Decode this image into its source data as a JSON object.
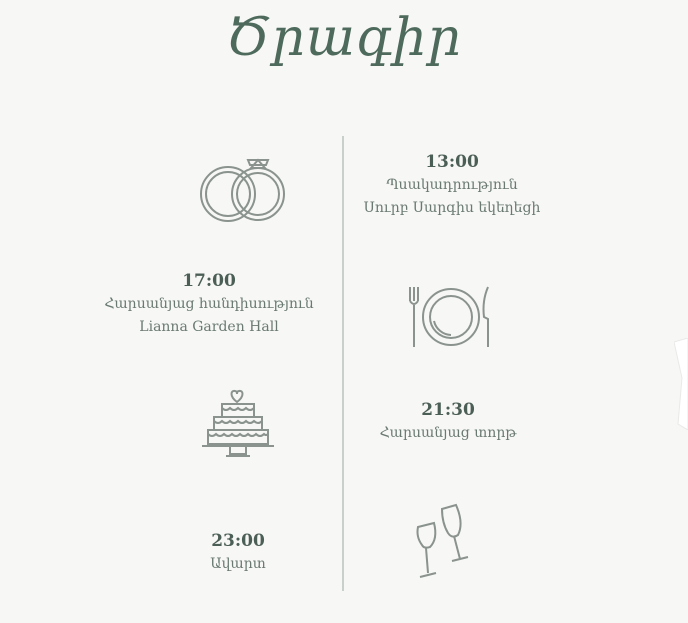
{
  "title": "Ծրագիր",
  "events": [
    {
      "time": "13:00",
      "lines": [
        "Պսակադրություն",
        "Սուրբ Սարգիս եկեղեցի"
      ]
    },
    {
      "time": "17:00",
      "lines": [
        "Հարսանյաց հանդիսություն",
        "Lianna Garden Hall"
      ]
    },
    {
      "time": "21:30",
      "lines": [
        "Հարսանյաց տորթ"
      ]
    },
    {
      "time": "23:00",
      "lines": [
        "Ավարտ"
      ]
    }
  ],
  "icons": [
    "wedding-rings-icon",
    "dinner-plate-icon",
    "wedding-cake-icon",
    "champagne-glasses-icon"
  ],
  "colors": {
    "background": "#f7f7f5",
    "accent": "#4e6a5d",
    "text": "#6a7a72",
    "divider": "#c9d0cb"
  }
}
